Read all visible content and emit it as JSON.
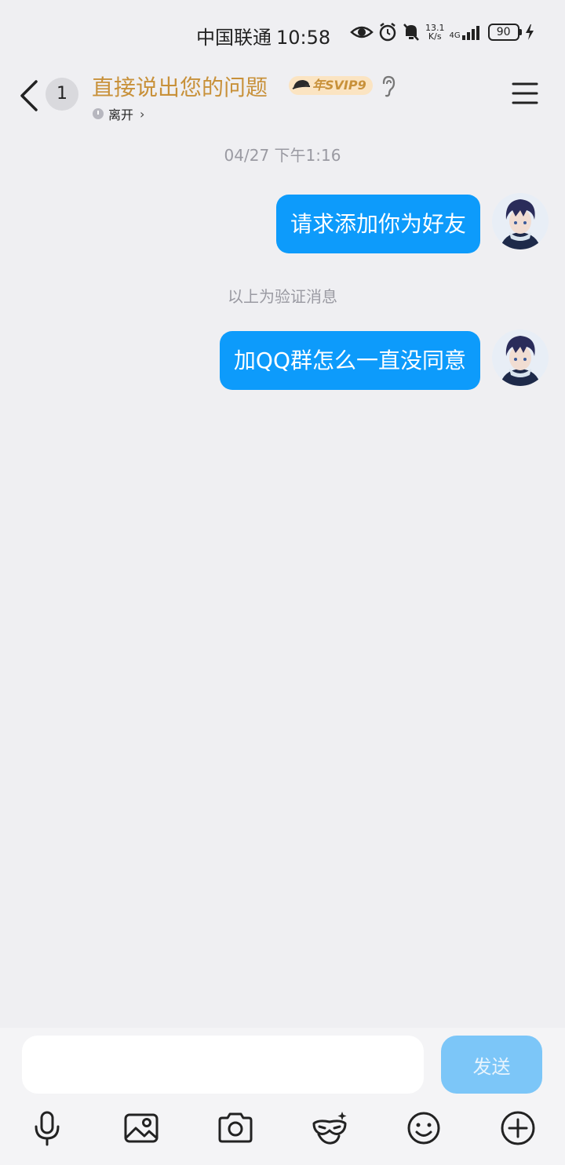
{
  "status_bar": {
    "carrier": "中国联通",
    "time": "10:58",
    "net_speed_value": "13.1",
    "net_speed_unit": "K/s",
    "network_type": "4G",
    "battery": "90"
  },
  "header": {
    "unread_count": "1",
    "title": "直接说出您的问题",
    "vip_badge": "年SVIP9",
    "presence": "离开"
  },
  "messages": {
    "timestamp": "04/27 下午1:16",
    "items": [
      {
        "text": "请求添加你为好友",
        "sender": "self"
      },
      {
        "text": "加QQ群怎么一直没同意",
        "sender": "self"
      }
    ],
    "system_note": "以上为验证消息"
  },
  "input": {
    "value": "",
    "send_label": "发送"
  },
  "toolbar": {
    "icons": [
      "microphone-icon",
      "image-icon",
      "camera-icon",
      "sticker-mask-icon",
      "emoji-icon",
      "plus-icon"
    ]
  },
  "colors": {
    "bubble": "#0d9bfb",
    "title": "#c8913a",
    "send_disabled": "#7cc6f8",
    "background": "#efeff2"
  }
}
